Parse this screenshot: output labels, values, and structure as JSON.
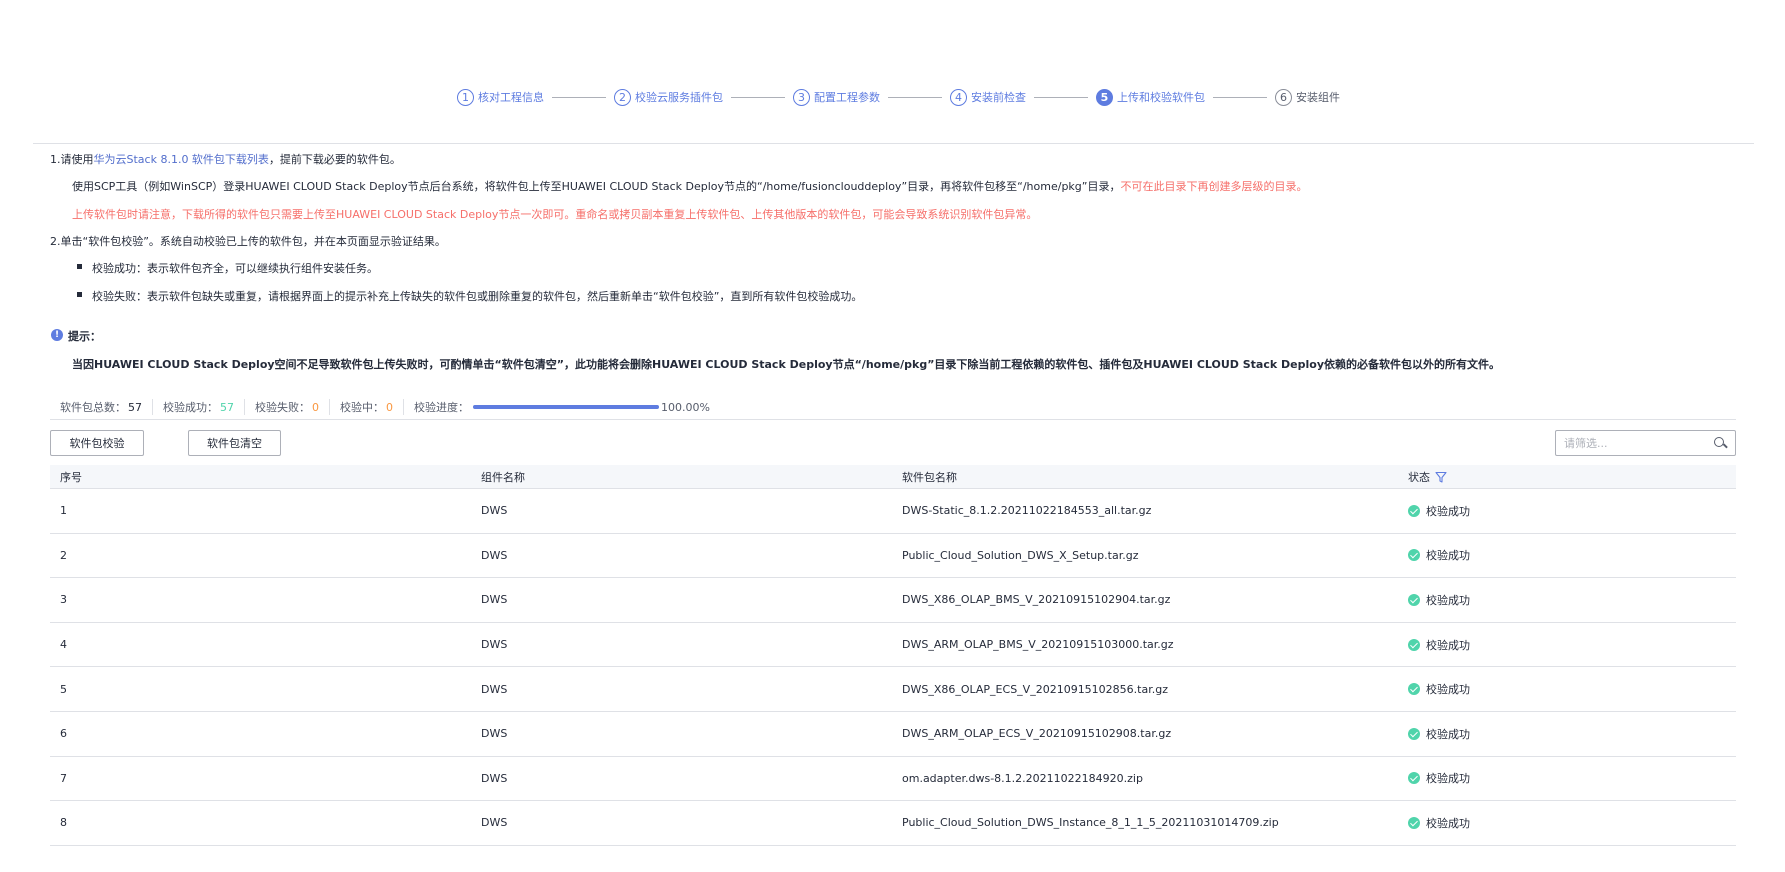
{
  "stepper": {
    "steps": [
      {
        "num": "1",
        "label": "核对工程信息"
      },
      {
        "num": "2",
        "label": "校验云服务插件包"
      },
      {
        "num": "3",
        "label": "配置工程参数"
      },
      {
        "num": "4",
        "label": "安装前检查"
      },
      {
        "num": "5",
        "label": "上传和校验软件包"
      },
      {
        "num": "6",
        "label": "安装组件"
      }
    ],
    "current_step": 5,
    "accent_color": "#5e7ce0"
  },
  "instructions": {
    "line1_prefix": "1.请使用",
    "line1_link": "华为云Stack 8.1.0 软件包下载列表",
    "line1_suffix": "，提前下载必要的软件包。",
    "line2_text": "使用SCP工具（例如WinSCP）登录HUAWEI CLOUD Stack Deploy节点后台系统，将软件包上传至HUAWEI CLOUD Stack Deploy节点的“/home/fusionclouddeploy”目录，再将软件包移至“/home/pkg”目录，",
    "line2_warning": "不可在此目录下再创建多层级的目录。",
    "line3_warning": "上传软件包时请注意，下载所得的软件包只需要上传至HUAWEI CLOUD Stack Deploy节点一次即可。重命名或拷贝副本重复上传软件包、上传其他版本的软件包，可能会导致系统识别软件包异常。",
    "line4": "2.单击“软件包校验”。系统自动校验已上传的软件包，并在本页面显示验证结果。",
    "bullet1": "校验成功：表示软件包齐全，可以继续执行组件安装任务。",
    "bullet2": "校验失败：表示软件包缺失或重复，请根据界面上的提示补充上传缺失的软件包或删除重复的软件包，然后重新单击“软件包校验”，直到所有软件包校验成功。"
  },
  "tip": {
    "icon": "!",
    "title": "提示：",
    "text": "当因HUAWEI CLOUD Stack Deploy空间不足导致软件包上传失败时，可酌情单击“软件包清空”，此功能将会删除HUAWEI CLOUD Stack Deploy节点“/home/pkg”目录下除当前工程依赖的软件包、插件包及HUAWEI CLOUD Stack Deploy依赖的必备软件包以外的所有文件。"
  },
  "stats": {
    "total_label": "软件包总数：",
    "total_value": "57",
    "success_label": "校验成功：",
    "success_value": "57",
    "fail_label": "校验失败：",
    "fail_value": "0",
    "checking_label": "校验中：",
    "checking_value": "0",
    "progress_label": "校验进度：",
    "progress_value": "100.00%",
    "progress_fraction": 1.0
  },
  "toolbar": {
    "verify_label": "软件包校验",
    "clear_label": "软件包清空",
    "search_placeholder": "请筛选..."
  },
  "table": {
    "headers": [
      "序号",
      "组件名称",
      "软件包名称",
      "状态"
    ],
    "rows": [
      {
        "no": "1",
        "component": "DWS",
        "package": "DWS-Static_8.1.2.20211022184553_all.tar.gz",
        "status": "校验成功"
      },
      {
        "no": "2",
        "component": "DWS",
        "package": "Public_Cloud_Solution_DWS_X_Setup.tar.gz",
        "status": "校验成功"
      },
      {
        "no": "3",
        "component": "DWS",
        "package": "DWS_X86_OLAP_BMS_V_20210915102904.tar.gz",
        "status": "校验成功"
      },
      {
        "no": "4",
        "component": "DWS",
        "package": "DWS_ARM_OLAP_BMS_V_20210915103000.tar.gz",
        "status": "校验成功"
      },
      {
        "no": "5",
        "component": "DWS",
        "package": "DWS_X86_OLAP_ECS_V_20210915102856.tar.gz",
        "status": "校验成功"
      },
      {
        "no": "6",
        "component": "DWS",
        "package": "DWS_ARM_OLAP_ECS_V_20210915102908.tar.gz",
        "status": "校验成功"
      },
      {
        "no": "7",
        "component": "DWS",
        "package": "om.adapter.dws-8.1.2.20211022184920.zip",
        "status": "校验成功"
      },
      {
        "no": "8",
        "component": "DWS",
        "package": "Public_Cloud_Solution_DWS_Instance_8_1_1_5_20211031014709.zip",
        "status": "校验成功"
      }
    ],
    "status_color": "#50d4ab"
  }
}
